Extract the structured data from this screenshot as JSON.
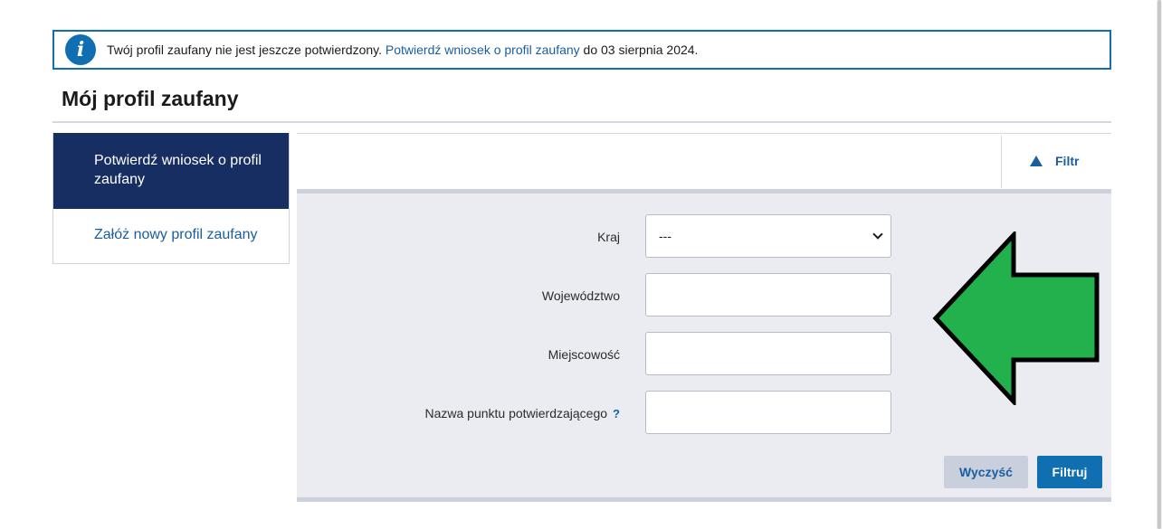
{
  "notice": {
    "icon": "info-icon",
    "text_before": "Twój profil zaufany nie jest jeszcze potwierdzony. ",
    "link_text": "Potwierdź wniosek o profil zaufany",
    "text_after": " do 03 sierpnia 2024."
  },
  "page": {
    "title": "Mój profil zaufany"
  },
  "sidebar": {
    "items": [
      {
        "label": "Potwierdź wniosek o profil zaufany",
        "active": true
      },
      {
        "label": "Załóż nowy profil zaufany",
        "active": false
      }
    ]
  },
  "filter": {
    "toggle_label": "Filtr",
    "toggle_icon": "triangle-up-icon",
    "fields": {
      "country": {
        "label": "Kraj",
        "value": "---"
      },
      "voivodeship": {
        "label": "Województwo",
        "value": ""
      },
      "city": {
        "label": "Miejscowość",
        "value": ""
      },
      "point_name": {
        "label": "Nazwa punktu potwierdzającego",
        "help": "?",
        "value": ""
      }
    },
    "buttons": {
      "clear": "Wyczyść",
      "submit": "Filtruj"
    }
  },
  "colors": {
    "primary_blue": "#0f6fb0",
    "link_blue": "#1a5ea0",
    "sidebar_active_bg": "#172e63",
    "panel_bg": "#eaecf1",
    "arrow_green": "#22b14c"
  }
}
